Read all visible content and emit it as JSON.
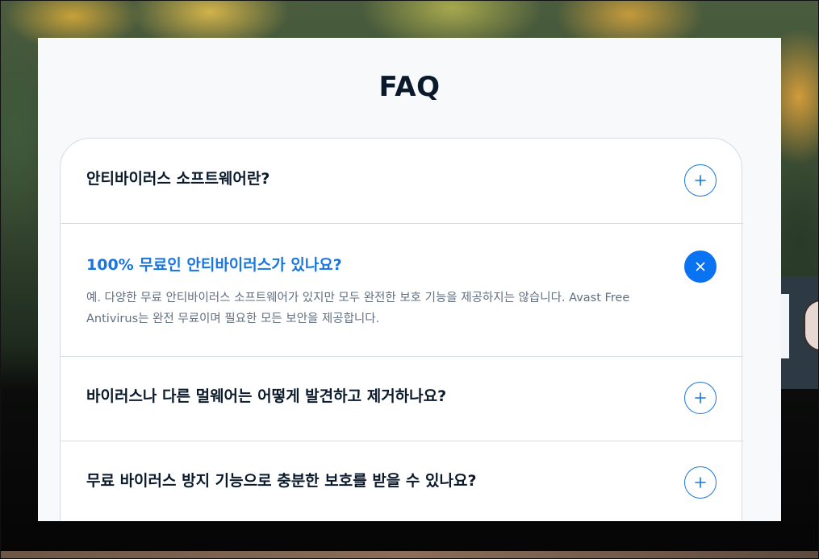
{
  "faq": {
    "title": "FAQ",
    "items": [
      {
        "question": "안티바이러스 소프트웨어란?",
        "expanded": false,
        "toggle_icon": "plus-icon"
      },
      {
        "question": "100% 무료인 안티바이러스가 있나요?",
        "expanded": true,
        "toggle_icon": "close-icon",
        "answer": "예. 다양한 무료 안티바이러스 소프트웨어가 있지만 모두 완전한 보호 기능을 제공하지는 않습니다. Avast Free Antivirus는 완전 무료이며 필요한 모든 보안을 제공합니다."
      },
      {
        "question": "바이러스나 다른 멀웨어는 어떻게 발견하고 제거하나요?",
        "expanded": false,
        "toggle_icon": "plus-icon"
      },
      {
        "question": "무료 바이러스 방지 기능으로 충분한 보호를 받을 수 있나요?",
        "expanded": false,
        "toggle_icon": "plus-icon"
      }
    ]
  },
  "colors": {
    "accent": "#0a73f2",
    "active_question": "#1976e0",
    "question": "#0b1a2b",
    "answer": "#5f6f80",
    "divider": "#d4dde4",
    "modal_bg": "#f7f9fb"
  }
}
